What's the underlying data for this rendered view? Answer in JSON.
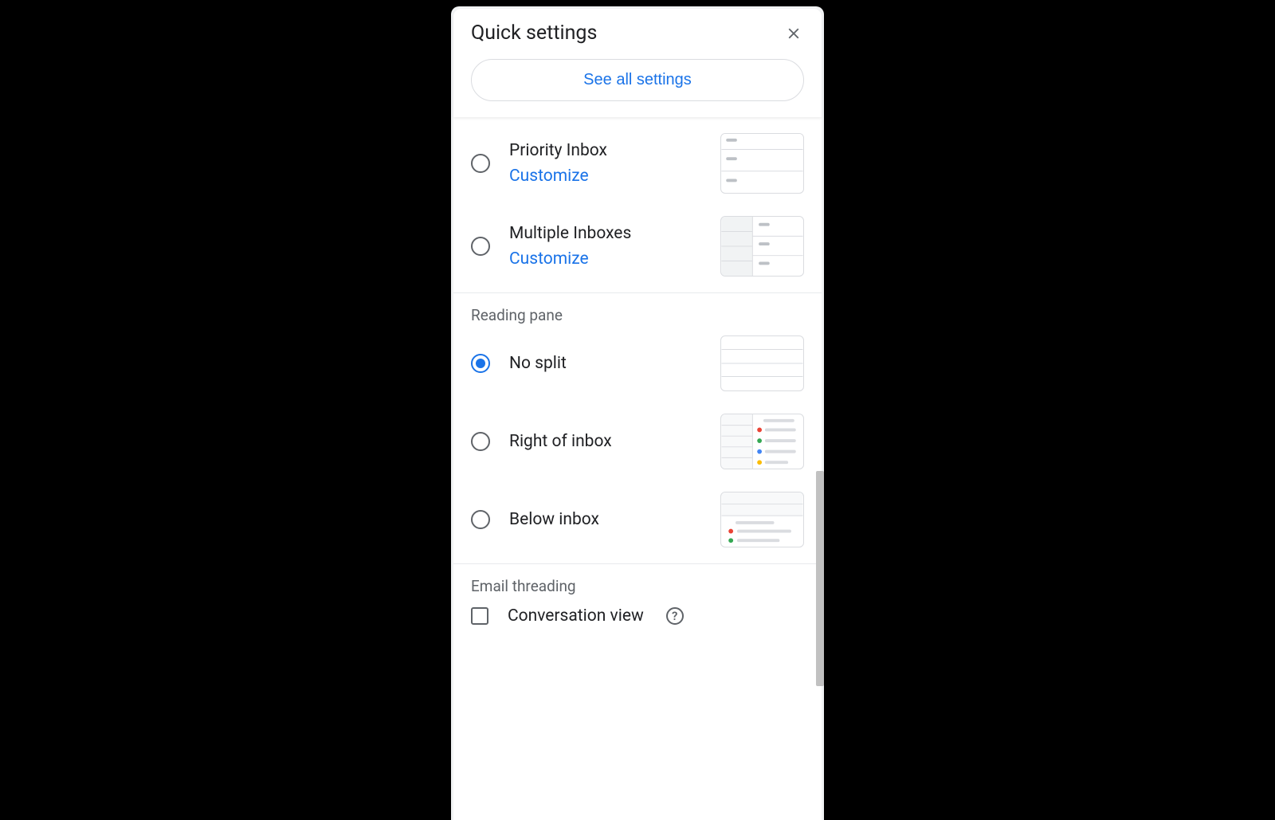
{
  "header": {
    "title": "Quick settings",
    "see_all_label": "See all settings"
  },
  "inbox_section": {
    "options": [
      {
        "label": "Priority Inbox",
        "customize_label": "Customize",
        "selected": false
      },
      {
        "label": "Multiple Inboxes",
        "customize_label": "Customize",
        "selected": false
      }
    ]
  },
  "reading_pane_section": {
    "title": "Reading pane",
    "options": [
      {
        "label": "No split",
        "selected": true
      },
      {
        "label": "Right of inbox",
        "selected": false
      },
      {
        "label": "Below inbox",
        "selected": false
      }
    ]
  },
  "email_threading_section": {
    "title": "Email threading",
    "conversation_view_label": "Conversation view",
    "conversation_view_checked": false
  },
  "colors": {
    "accent": "#1a73e8",
    "text_primary": "#202124",
    "text_secondary": "#5f6368",
    "border": "#dadce0"
  }
}
